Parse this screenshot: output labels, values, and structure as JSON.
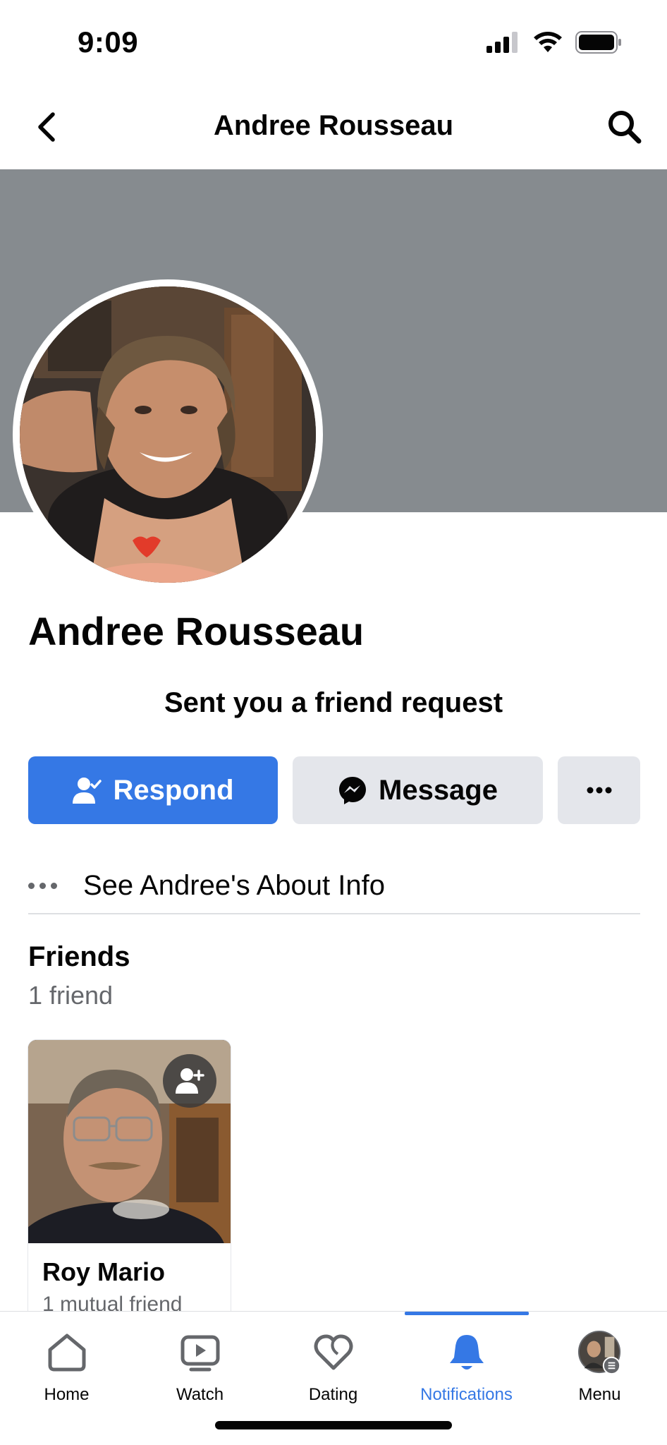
{
  "status_bar": {
    "time": "9:09",
    "icons": [
      "signal-icon",
      "wifi-icon",
      "battery-icon"
    ]
  },
  "header": {
    "title": "Andree Rousseau",
    "back_icon": "chevron-left-icon",
    "search_icon": "search-icon"
  },
  "profile": {
    "name": "Andree Rousseau",
    "request_text": "Sent you a friend request",
    "cover_color": "#868b8f"
  },
  "actions": {
    "respond_label": "Respond",
    "message_label": "Message",
    "more_icon": "more-horizontal-icon"
  },
  "about": {
    "label": "See Andree's About Info"
  },
  "friends": {
    "title": "Friends",
    "count": "1 friend",
    "items": [
      {
        "name": "Roy Mario",
        "mutual": "1 mutual friend"
      }
    ]
  },
  "bottom_nav": {
    "items": [
      {
        "label": "Home",
        "icon": "home-icon"
      },
      {
        "label": "Watch",
        "icon": "watch-icon"
      },
      {
        "label": "Dating",
        "icon": "dating-heart-icon"
      },
      {
        "label": "Notifications",
        "icon": "bell-icon"
      },
      {
        "label": "Menu",
        "icon": "avatar-menu-icon"
      }
    ],
    "active": "Notifications"
  },
  "colors": {
    "accent": "#3578e5",
    "button_gray": "#e4e6eb",
    "secondary_text": "#65676b"
  }
}
